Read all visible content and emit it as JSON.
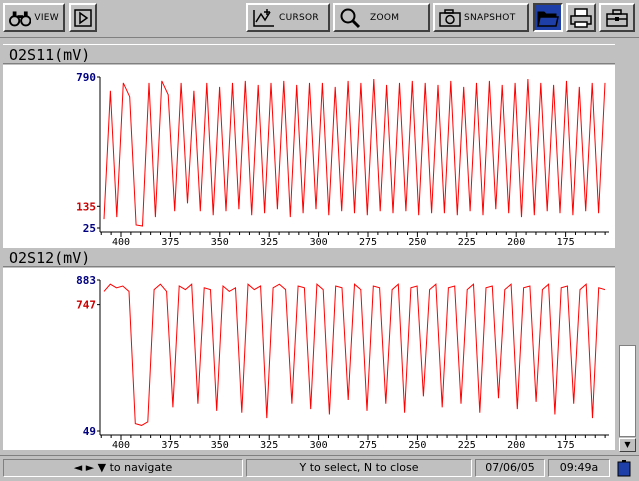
{
  "toolbar": {
    "view_label": "VIEW",
    "cursor_label": "CURSOR",
    "zoom_label": "ZOOM",
    "snapshot_label": "SNAPSHOT"
  },
  "panels": [
    {
      "title": "O2S11(mV)",
      "y_max": "790",
      "y_mid": "135",
      "y_min": "25",
      "x_ticks": [
        "400",
        "375",
        "350",
        "325",
        "300",
        "275",
        "250",
        "225",
        "200",
        "175"
      ]
    },
    {
      "title": "O2S12(mV)",
      "y_max": "883",
      "y_mid": "747",
      "y_min": "49",
      "x_ticks": [
        "400",
        "375",
        "350",
        "325",
        "300",
        "275",
        "250",
        "225",
        "200",
        "175"
      ]
    }
  ],
  "status": {
    "nav_text": "◄ ► ▼ to navigate",
    "select_text": "Y to select, N to close",
    "date": "07/06/05",
    "time": "09:49a"
  },
  "colors": {
    "trace": "#ff0000",
    "max_label": "#000080",
    "mid_label": "#cc0000"
  },
  "chart_data": [
    {
      "type": "line",
      "title": "O2S11(mV)",
      "ylabel": "mV",
      "ylim": [
        25,
        790
      ],
      "x_ticks": [
        400,
        375,
        350,
        325,
        300,
        275,
        250,
        225,
        200,
        175
      ],
      "series": [
        {
          "values": [
            70,
            720,
            80,
            760,
            690,
            40,
            35,
            760,
            80,
            770,
            700,
            110,
            760,
            150,
            720,
            110,
            760,
            90,
            740,
            110,
            760,
            120,
            770,
            90,
            750,
            100,
            760,
            120,
            770,
            80,
            750,
            100,
            760,
            120,
            760,
            90,
            740,
            110,
            770,
            100,
            760,
            90,
            780,
            110,
            750,
            100,
            760,
            110,
            770,
            90,
            760,
            100,
            750,
            100,
            770,
            90,
            740,
            110,
            760,
            90,
            770,
            120,
            750,
            100,
            760,
            80,
            780,
            90,
            760,
            110,
            750,
            100,
            770,
            90,
            740,
            110,
            760,
            100,
            760
          ]
        }
      ]
    },
    {
      "type": "line",
      "title": "O2S12(mV)",
      "ylabel": "mV",
      "ylim": [
        49,
        883
      ],
      "x_ticks": [
        400,
        375,
        350,
        325,
        300,
        275,
        250,
        225,
        200,
        175
      ],
      "series": [
        {
          "values": [
            820,
            860,
            840,
            850,
            820,
            90,
            80,
            100,
            830,
            860,
            820,
            180,
            850,
            830,
            860,
            200,
            840,
            830,
            160,
            850,
            820,
            840,
            150,
            860,
            830,
            850,
            120,
            840,
            860,
            830,
            200,
            850,
            840,
            170,
            860,
            830,
            140,
            850,
            840,
            220,
            860,
            830,
            160,
            850,
            840,
            200,
            830,
            860,
            150,
            840,
            850,
            240,
            830,
            860,
            180,
            840,
            850,
            200,
            830,
            860,
            150,
            840,
            850,
            230,
            830,
            860,
            170,
            840,
            850,
            210,
            830,
            860,
            140,
            840,
            850,
            200,
            830,
            860,
            120,
            840,
            830
          ]
        }
      ]
    }
  ]
}
